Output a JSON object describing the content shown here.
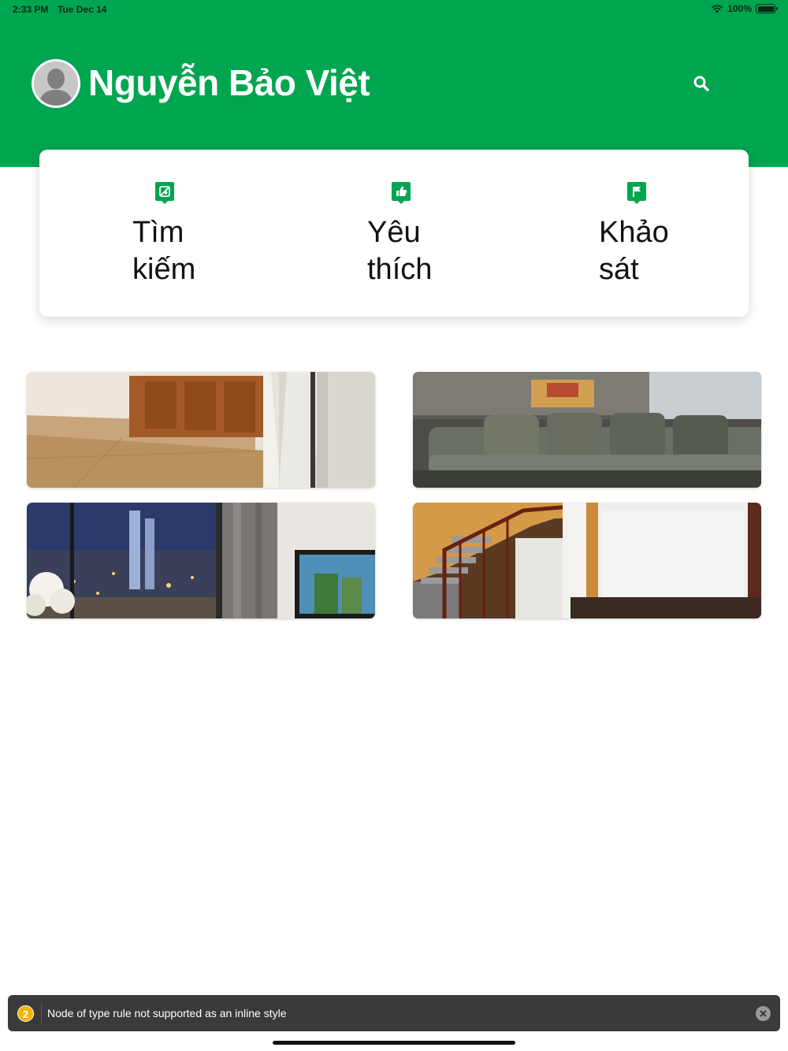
{
  "status_bar": {
    "time": "2:33 PM",
    "date": "Tue Dec 14",
    "battery": "100%"
  },
  "header": {
    "user_name": "Nguyễn Bảo Việt",
    "background_color": "#00A550",
    "avatar": "default-user-avatar"
  },
  "menu": {
    "items": [
      {
        "label": "Tìm kiếm",
        "icon": "search-location-icon"
      },
      {
        "label": "Yêu thích",
        "icon": "thumbs-up-icon"
      },
      {
        "label": "Khảo sát",
        "icon": "flag-icon"
      }
    ]
  },
  "gallery": {
    "photos": [
      {
        "subject": "kitchen-cabinets-photo"
      },
      {
        "subject": "living-room-sofa-photo"
      },
      {
        "subject": "city-view-window-photo"
      },
      {
        "subject": "staircase-hall-photo"
      }
    ]
  },
  "toast": {
    "count": "2",
    "message": "Node of type rule not supported as an inline style",
    "badge_color": "#f5b400"
  }
}
